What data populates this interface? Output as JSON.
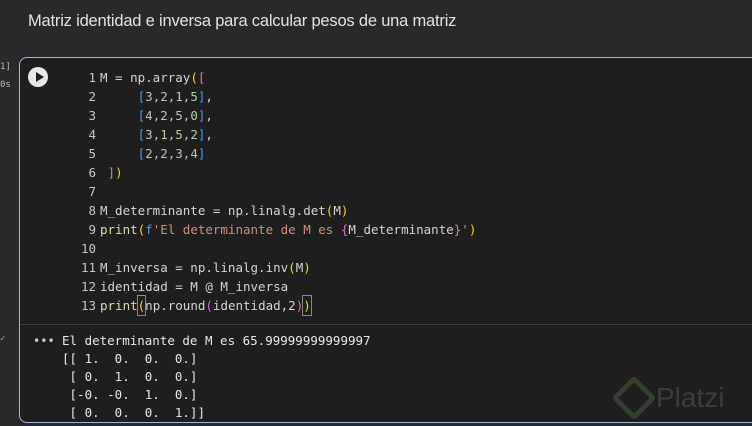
{
  "title": "Matriz identidad e inversa para calcular pesos de una matriz",
  "exec_count": "1]",
  "exec_time": "0s",
  "code_lines": [
    [
      [
        "def",
        "M = np.array"
      ],
      [
        "b1",
        "("
      ],
      [
        "b2",
        "["
      ]
    ],
    [
      [
        "def",
        "     "
      ],
      [
        "b3",
        "["
      ],
      [
        "num",
        "3,2,1,5"
      ],
      [
        "b3",
        "]"
      ],
      [
        "def",
        ","
      ]
    ],
    [
      [
        "def",
        "     "
      ],
      [
        "b3",
        "["
      ],
      [
        "num",
        "4,2,5,0"
      ],
      [
        "b3",
        "]"
      ],
      [
        "def",
        ","
      ]
    ],
    [
      [
        "def",
        "     "
      ],
      [
        "b3",
        "["
      ],
      [
        "num",
        "3,1,5,2"
      ],
      [
        "b3",
        "]"
      ],
      [
        "def",
        ","
      ]
    ],
    [
      [
        "def",
        "     "
      ],
      [
        "b3",
        "["
      ],
      [
        "num",
        "2,2,3,4"
      ],
      [
        "b3",
        "]"
      ]
    ],
    [
      [
        "def",
        " "
      ],
      [
        "b2",
        "]"
      ],
      [
        "b1",
        ")"
      ]
    ],
    [],
    [
      [
        "def",
        "M_determinante = np.linalg.det"
      ],
      [
        "b1",
        "("
      ],
      [
        "def",
        "M"
      ],
      [
        "b1",
        ")"
      ]
    ],
    [
      [
        "fn",
        "print"
      ],
      [
        "b1",
        "("
      ],
      [
        "kw",
        "f"
      ],
      [
        "str",
        "'El determinante de M es "
      ],
      [
        "b2",
        "{"
      ],
      [
        "def",
        "M_determinante"
      ],
      [
        "b2",
        "}"
      ],
      [
        "str",
        "'"
      ],
      [
        "b1",
        ")"
      ]
    ],
    [],
    [
      [
        "def",
        "M_inversa = np.linalg.inv"
      ],
      [
        "b1",
        "("
      ],
      [
        "def",
        "M"
      ],
      [
        "b1",
        ")"
      ]
    ],
    [
      [
        "def",
        "identidad = M @ M_inversa"
      ]
    ],
    [
      [
        "fn",
        "print"
      ],
      [
        "b1cur",
        "("
      ],
      [
        "def",
        "np.round"
      ],
      [
        "b2",
        "("
      ],
      [
        "def",
        "identidad,2"
      ],
      [
        "b2",
        ")"
      ],
      [
        "b1cur",
        ")"
      ]
    ]
  ],
  "output_lines": [
    "El determinante de M es 65.99999999999997",
    "[[ 1.  0.  0.  0.]",
    " [ 0.  1.  0.  0.]",
    " [-0. -0.  1.  0.]",
    " [ 0.  0.  0.  1.]]"
  ],
  "output_menu": "•••",
  "watermark": "Platzi"
}
